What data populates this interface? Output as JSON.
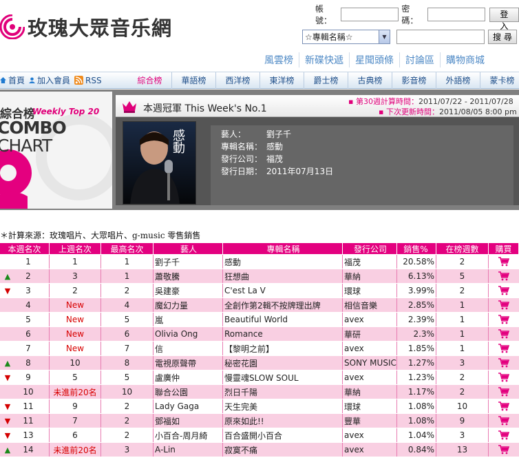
{
  "site": {
    "name": "玫瑰大眾音乐網"
  },
  "login": {
    "account_label": "帳號：",
    "password_label": "密碼：",
    "login_button": "登 入"
  },
  "search": {
    "selected_option": "☆專輯名稱☆",
    "button": "搜 尋"
  },
  "top_tabs": [
    "風雲榜",
    "新碟快遞",
    "星聞頭條",
    "討論區",
    "購物商城"
  ],
  "nav": {
    "links": [
      {
        "label": "首頁",
        "icon": "home-icon"
      },
      {
        "label": "加入會員",
        "icon": "user-icon"
      },
      {
        "label": "RSS",
        "icon": "rss-icon"
      }
    ],
    "categories": [
      "綜合榜",
      "華語榜",
      "西洋榜",
      "東洋榜",
      "爵士榜",
      "古典榜",
      "影音榜",
      "外語榜",
      "蒙卡榜"
    ],
    "active_category": "綜合榜"
  },
  "banner": {
    "chart_label": "綜合榜",
    "weekly_top": "Weekly Top 20",
    "combo_line1": "COMBO",
    "combo_line2": "CHART",
    "champion_title": "本週冠軍 This Week's No.1",
    "calc_label": "第30週計算時間：",
    "calc_value": "2011/07/22 - 2011/07/28",
    "update_label": "下次更新時間：",
    "update_value": "2011/08/05 8:00 pm",
    "cover_text": "感動",
    "info": [
      {
        "label": "藝人：",
        "value": "劉子千"
      },
      {
        "label": "專輯名稱：",
        "value": "感動"
      },
      {
        "label": "發行公司：",
        "value": "福茂"
      },
      {
        "label": "發行日期：",
        "value": "2011年07月13日"
      }
    ]
  },
  "source_line": "＊計算來源：玫瑰唱片、大眾唱片、g-music 零售銷售",
  "table": {
    "headers": [
      "本週名次",
      "上週名次",
      "最高名次",
      "藝人",
      "專輯名稱",
      "發行公司",
      "銷售%",
      "在榜週數",
      "購買"
    ],
    "rows": [
      {
        "rank": "1",
        "trend": "",
        "last": "1",
        "last_red": false,
        "peak": "1",
        "artist": "劉子千",
        "album": "感動",
        "label": "福茂",
        "sales": "20.58%",
        "weeks": "2"
      },
      {
        "rank": "2",
        "trend": "up",
        "last": "3",
        "last_red": false,
        "peak": "1",
        "artist": "蕭敬騰",
        "album": "狂想曲",
        "label": "華納",
        "sales": "6.13%",
        "weeks": "5"
      },
      {
        "rank": "3",
        "trend": "down",
        "last": "2",
        "last_red": false,
        "peak": "2",
        "artist": "吳建豪",
        "album": "C'est La V",
        "label": "環球",
        "sales": "3.99%",
        "weeks": "2"
      },
      {
        "rank": "4",
        "trend": "",
        "last": "New",
        "last_red": true,
        "peak": "4",
        "artist": "魔幻力量",
        "album": "全創作第2輯不按牌理出牌",
        "label": "相信音樂",
        "sales": "2.85%",
        "weeks": "1"
      },
      {
        "rank": "5",
        "trend": "",
        "last": "New",
        "last_red": true,
        "peak": "5",
        "artist": "嵐",
        "album": "Beautiful World",
        "label": "avex",
        "sales": "2.39%",
        "weeks": "1"
      },
      {
        "rank": "6",
        "trend": "",
        "last": "New",
        "last_red": true,
        "peak": "6",
        "artist": "Olivia Ong",
        "album": "Romance",
        "label": "華研",
        "sales": "2.3%",
        "weeks": "1"
      },
      {
        "rank": "7",
        "trend": "",
        "last": "New",
        "last_red": true,
        "peak": "7",
        "artist": "信",
        "album": "【黎明之前】",
        "label": "avex",
        "sales": "1.85%",
        "weeks": "1"
      },
      {
        "rank": "8",
        "trend": "up",
        "last": "10",
        "last_red": false,
        "peak": "8",
        "artist": "電視原聲帶",
        "album": "秘密花園",
        "label": "SONY MUSIC",
        "sales": "1.27%",
        "weeks": "3"
      },
      {
        "rank": "9",
        "trend": "down",
        "last": "5",
        "last_red": false,
        "peak": "5",
        "artist": "盧廣仲",
        "album": "慢靈魂SLOW SOUL",
        "label": "avex",
        "sales": "1.23%",
        "weeks": "2"
      },
      {
        "rank": "10",
        "trend": "",
        "last": "未進前20名",
        "last_red": true,
        "peak": "10",
        "artist": "聯合公園",
        "album": "烈日千陽",
        "label": "華納",
        "sales": "1.17%",
        "weeks": "2"
      },
      {
        "rank": "11",
        "trend": "down",
        "last": "9",
        "last_red": false,
        "peak": "2",
        "artist": "Lady Gaga",
        "album": "天生完美",
        "label": "環球",
        "sales": "1.08%",
        "weeks": "10"
      },
      {
        "rank": "11",
        "trend": "down",
        "last": "7",
        "last_red": false,
        "peak": "2",
        "artist": "鄧福如",
        "album": "原來如此!!",
        "label": "豐華",
        "sales": "1.08%",
        "weeks": "9"
      },
      {
        "rank": "13",
        "trend": "down",
        "last": "6",
        "last_red": false,
        "peak": "2",
        "artist": "小百合-周月綺",
        "album": "百合盛開小百合",
        "label": "avex",
        "sales": "1.04%",
        "weeks": "3"
      },
      {
        "rank": "14",
        "trend": "up",
        "last": "未進前20名",
        "last_red": true,
        "peak": "3",
        "artist": "A-Lin",
        "album": "寂寞不痛",
        "label": "avex",
        "sales": "0.84%",
        "weeks": "13"
      }
    ]
  },
  "colors": {
    "accent": "#e3007f",
    "row_pink": "#f9cfe2",
    "nav_blue": "#1f4f8a",
    "tab_blue": "#4f8ac6",
    "up_green": "#1a8a1a",
    "down_red": "#d40000"
  }
}
